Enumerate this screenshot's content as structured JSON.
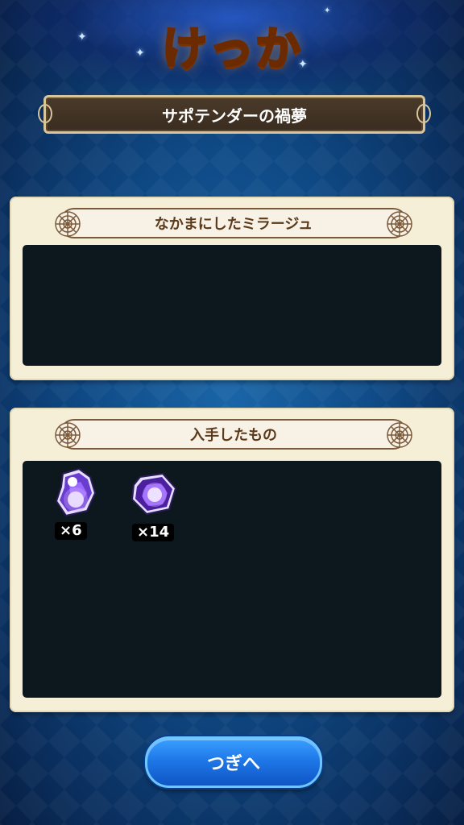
{
  "screen": {
    "title": "けっか",
    "stage_name": "サポテンダーの禍夢"
  },
  "allies_panel": {
    "header": "なかまにしたミラージュ",
    "items": []
  },
  "items_panel": {
    "header": "入手したもの",
    "items": [
      {
        "icon": "purple-magicite-fragment-icon",
        "quantity": "×6"
      },
      {
        "icon": "purple-crystal-icon",
        "quantity": "×14"
      }
    ]
  },
  "next_button": {
    "label": "つぎへ"
  },
  "colors": {
    "title": "#ffcf2a",
    "panel": "#f5efd8",
    "panel_body": "#0c181d",
    "button": "#1f78e8"
  }
}
